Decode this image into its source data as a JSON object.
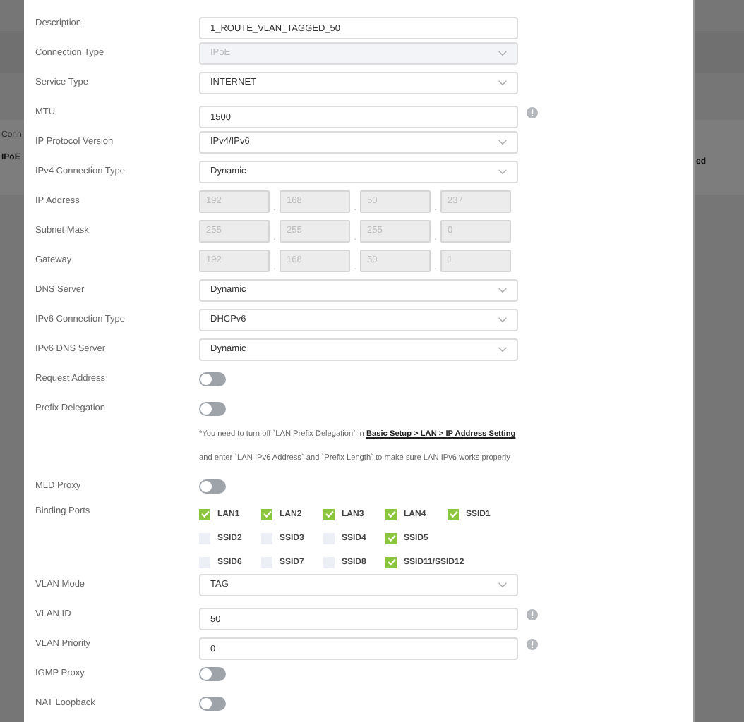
{
  "backdrop": {
    "left_texts": [
      "Conn",
      "IPoE"
    ],
    "right_texts": [
      "ed"
    ]
  },
  "form": {
    "rows": [
      {
        "kind": "text",
        "label": "Description",
        "value": "1_ROUTE_VLAN_TAGGED_50",
        "info": false
      },
      {
        "kind": "select",
        "label": "Connection Type",
        "value": "IPoE",
        "disabled": true
      },
      {
        "kind": "select",
        "label": "Service Type",
        "value": "INTERNET",
        "disabled": false
      },
      {
        "kind": "text",
        "label": "MTU",
        "value": "1500",
        "info": true
      },
      {
        "kind": "select",
        "label": "IP Protocol Version",
        "value": "IPv4/IPv6",
        "disabled": false
      },
      {
        "kind": "select",
        "label": "IPv4 Connection Type",
        "value": "Dynamic",
        "disabled": false
      },
      {
        "kind": "ip",
        "label": "IP Address",
        "octets": [
          "192",
          "168",
          "50",
          "237"
        ],
        "separators": [
          ".",
          ".",
          "."
        ],
        "disabled": true
      },
      {
        "kind": "ip",
        "label": "Subnet Mask",
        "octets": [
          "255",
          "255",
          "255",
          "0"
        ],
        "separators": [
          ".",
          ".",
          "."
        ],
        "disabled": true
      },
      {
        "kind": "ip",
        "label": "Gateway",
        "octets": [
          "192",
          "168",
          "50",
          "1"
        ],
        "separators": [
          ".",
          ".",
          "."
        ],
        "disabled": true
      },
      {
        "kind": "select",
        "label": "DNS Server",
        "value": "Dynamic",
        "disabled": false
      },
      {
        "kind": "select",
        "label": "IPv6 Connection Type",
        "value": "DHCPv6",
        "disabled": false
      },
      {
        "kind": "select",
        "label": "IPv6 DNS Server",
        "value": "Dynamic",
        "disabled": false
      },
      {
        "kind": "toggle",
        "label": "Request Address",
        "on": false
      },
      {
        "kind": "toggle",
        "label": "Prefix Delegation",
        "on": false
      },
      {
        "kind": "note",
        "before": "*You need to turn off `LAN Prefix Delegation` in ",
        "link": "Basic Setup > LAN > IP Address Setting",
        "after": " and enter `LAN IPv6 Address` and `Prefix Length` to make sure LAN IPv6 works properly"
      },
      {
        "kind": "toggle",
        "label": "MLD Proxy",
        "on": false
      },
      {
        "kind": "checkboxes",
        "label": "Binding Ports",
        "options": [
          {
            "label": "LAN1",
            "checked": true
          },
          {
            "label": "LAN2",
            "checked": true
          },
          {
            "label": "LAN3",
            "checked": true
          },
          {
            "label": "LAN4",
            "checked": true
          },
          {
            "label": "SSID1",
            "checked": true
          },
          {
            "label": "SSID2",
            "checked": false
          },
          {
            "label": "SSID3",
            "checked": false
          },
          {
            "label": "SSID4",
            "checked": false
          },
          {
            "label": "SSID5",
            "checked": true
          },
          {
            "label": "SSID6",
            "checked": false
          },
          {
            "label": "SSID7",
            "checked": false
          },
          {
            "label": "SSID8",
            "checked": false
          },
          {
            "label": "SSID11/SSID12",
            "checked": true
          }
        ]
      },
      {
        "kind": "select",
        "label": "VLAN Mode",
        "value": "TAG",
        "disabled": false
      },
      {
        "kind": "text",
        "label": "VLAN ID",
        "value": "50",
        "info": true
      },
      {
        "kind": "text",
        "label": "VLAN Priority",
        "value": "0",
        "info": true
      },
      {
        "kind": "toggle",
        "label": "IGMP Proxy",
        "on": false
      },
      {
        "kind": "toggle",
        "label": "NAT Loopback",
        "on": false
      }
    ]
  }
}
